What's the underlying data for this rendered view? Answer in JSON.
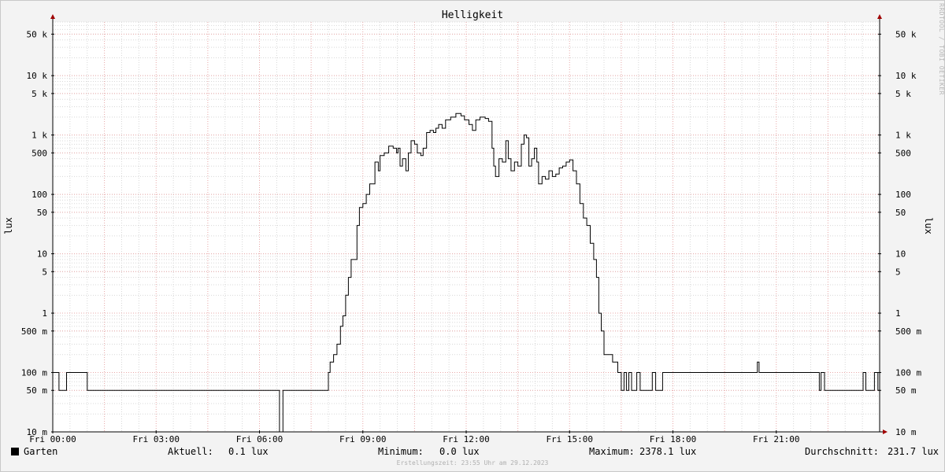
{
  "chart_data": {
    "type": "line",
    "title": "Helligkeit",
    "ylabel": "lux",
    "yscale": "log",
    "ylim": [
      0.01,
      80000
    ],
    "xlim": [
      0,
      24
    ],
    "x_ticks": [
      {
        "x": 0,
        "label": "Fri 00:00"
      },
      {
        "x": 3,
        "label": "Fri 03:00"
      },
      {
        "x": 6,
        "label": "Fri 06:00"
      },
      {
        "x": 9,
        "label": "Fri 09:00"
      },
      {
        "x": 12,
        "label": "Fri 12:00"
      },
      {
        "x": 15,
        "label": "Fri 15:00"
      },
      {
        "x": 18,
        "label": "Fri 18:00"
      },
      {
        "x": 21,
        "label": "Fri 21:00"
      }
    ],
    "y_ticks": [
      {
        "v": 50000,
        "label": "50 k"
      },
      {
        "v": 10000,
        "label": "10 k"
      },
      {
        "v": 5000,
        "label": "5 k"
      },
      {
        "v": 1000,
        "label": "1 k"
      },
      {
        "v": 500,
        "label": "500"
      },
      {
        "v": 100,
        "label": "100"
      },
      {
        "v": 50,
        "label": "50"
      },
      {
        "v": 10,
        "label": "10"
      },
      {
        "v": 5,
        "label": "5"
      },
      {
        "v": 1,
        "label": "1"
      },
      {
        "v": 0.5,
        "label": "500 m"
      },
      {
        "v": 0.1,
        "label": "100 m"
      },
      {
        "v": 0.05,
        "label": "50 m"
      },
      {
        "v": 0.01,
        "label": "10 m"
      }
    ],
    "grid": true,
    "series": [
      {
        "name": "Garten",
        "color": "#000000",
        "points": [
          [
            0.0,
            0.1
          ],
          [
            0.15,
            0.1
          ],
          [
            0.18,
            0.05
          ],
          [
            0.35,
            0.05
          ],
          [
            0.4,
            0.1
          ],
          [
            0.95,
            0.1
          ],
          [
            1.0,
            0.05
          ],
          [
            6.55,
            0.05
          ],
          [
            6.58,
            0.01
          ],
          [
            6.65,
            0.01
          ],
          [
            6.68,
            0.05
          ],
          [
            7.95,
            0.05
          ],
          [
            8.0,
            0.1
          ],
          [
            8.05,
            0.15
          ],
          [
            8.15,
            0.2
          ],
          [
            8.25,
            0.3
          ],
          [
            8.35,
            0.6
          ],
          [
            8.42,
            0.9
          ],
          [
            8.5,
            2
          ],
          [
            8.58,
            4
          ],
          [
            8.66,
            8
          ],
          [
            8.75,
            8
          ],
          [
            8.83,
            30
          ],
          [
            8.9,
            60
          ],
          [
            9.0,
            70
          ],
          [
            9.1,
            100
          ],
          [
            9.2,
            150
          ],
          [
            9.35,
            350
          ],
          [
            9.45,
            250
          ],
          [
            9.5,
            450
          ],
          [
            9.62,
            500
          ],
          [
            9.75,
            650
          ],
          [
            9.88,
            600
          ],
          [
            9.98,
            500
          ],
          [
            10.02,
            600
          ],
          [
            10.08,
            300
          ],
          [
            10.15,
            400
          ],
          [
            10.25,
            250
          ],
          [
            10.32,
            500
          ],
          [
            10.4,
            800
          ],
          [
            10.5,
            700
          ],
          [
            10.58,
            500
          ],
          [
            10.68,
            450
          ],
          [
            10.75,
            600
          ],
          [
            10.85,
            1100
          ],
          [
            10.95,
            1200
          ],
          [
            11.05,
            1100
          ],
          [
            11.12,
            1300
          ],
          [
            11.2,
            1500
          ],
          [
            11.3,
            1300
          ],
          [
            11.4,
            1800
          ],
          [
            11.55,
            2000
          ],
          [
            11.7,
            2300
          ],
          [
            11.85,
            2100
          ],
          [
            11.95,
            1800
          ],
          [
            12.08,
            1500
          ],
          [
            12.18,
            1200
          ],
          [
            12.28,
            1800
          ],
          [
            12.4,
            2000
          ],
          [
            12.55,
            1900
          ],
          [
            12.65,
            1700
          ],
          [
            12.75,
            600
          ],
          [
            12.8,
            300
          ],
          [
            12.85,
            200
          ],
          [
            12.95,
            400
          ],
          [
            13.05,
            350
          ],
          [
            13.15,
            800
          ],
          [
            13.22,
            400
          ],
          [
            13.3,
            250
          ],
          [
            13.4,
            350
          ],
          [
            13.5,
            300
          ],
          [
            13.6,
            700
          ],
          [
            13.68,
            1000
          ],
          [
            13.75,
            900
          ],
          [
            13.82,
            300
          ],
          [
            13.9,
            400
          ],
          [
            13.98,
            600
          ],
          [
            14.05,
            350
          ],
          [
            14.1,
            150
          ],
          [
            14.2,
            200
          ],
          [
            14.3,
            180
          ],
          [
            14.4,
            250
          ],
          [
            14.5,
            200
          ],
          [
            14.6,
            220
          ],
          [
            14.7,
            280
          ],
          [
            14.8,
            300
          ],
          [
            14.9,
            350
          ],
          [
            15.0,
            380
          ],
          [
            15.1,
            250
          ],
          [
            15.2,
            150
          ],
          [
            15.3,
            70
          ],
          [
            15.4,
            40
          ],
          [
            15.5,
            30
          ],
          [
            15.6,
            15
          ],
          [
            15.7,
            8
          ],
          [
            15.78,
            4
          ],
          [
            15.85,
            1
          ],
          [
            15.92,
            0.5
          ],
          [
            16.0,
            0.2
          ],
          [
            16.1,
            0.2
          ],
          [
            16.25,
            0.15
          ],
          [
            16.4,
            0.1
          ],
          [
            16.5,
            0.05
          ],
          [
            16.58,
            0.1
          ],
          [
            16.65,
            0.05
          ],
          [
            16.72,
            0.1
          ],
          [
            16.8,
            0.05
          ],
          [
            16.9,
            0.05
          ],
          [
            16.95,
            0.1
          ],
          [
            17.05,
            0.05
          ],
          [
            17.4,
            0.1
          ],
          [
            17.5,
            0.05
          ],
          [
            17.65,
            0.05
          ],
          [
            17.7,
            0.1
          ],
          [
            20.4,
            0.1
          ],
          [
            20.45,
            0.15
          ],
          [
            20.5,
            0.1
          ],
          [
            22.2,
            0.1
          ],
          [
            22.25,
            0.05
          ],
          [
            22.3,
            0.1
          ],
          [
            22.4,
            0.05
          ],
          [
            23.5,
            0.05
          ],
          [
            23.52,
            0.1
          ],
          [
            23.6,
            0.05
          ],
          [
            23.8,
            0.05
          ],
          [
            23.85,
            0.1
          ],
          [
            23.95,
            0.05
          ],
          [
            24.0,
            0.05
          ]
        ]
      }
    ]
  },
  "legend": {
    "series_name": "Garten",
    "aktuell_label": "Aktuell:",
    "aktuell_value": "0.1 lux",
    "minimum_label": "Minimum:",
    "minimum_value": "0.0 lux",
    "maximum_label": "Maximum:",
    "maximum_value": "2378.1 lux",
    "durchschnitt_label": "Durchschnitt:",
    "durchschnitt_value": "231.7 lux"
  },
  "footer": "Erstellungszeit: 23:55 Uhr am 29.12.2023",
  "watermark": "RRDTOOL / TOBI OETIKER",
  "colors": {
    "background": "#f3f3f3",
    "canvas": "#ffffff",
    "major_grid": "#e8a8a8",
    "minor_grid": "#d8d8d8",
    "axis_arrow": "#a00000",
    "line": "#000000"
  }
}
